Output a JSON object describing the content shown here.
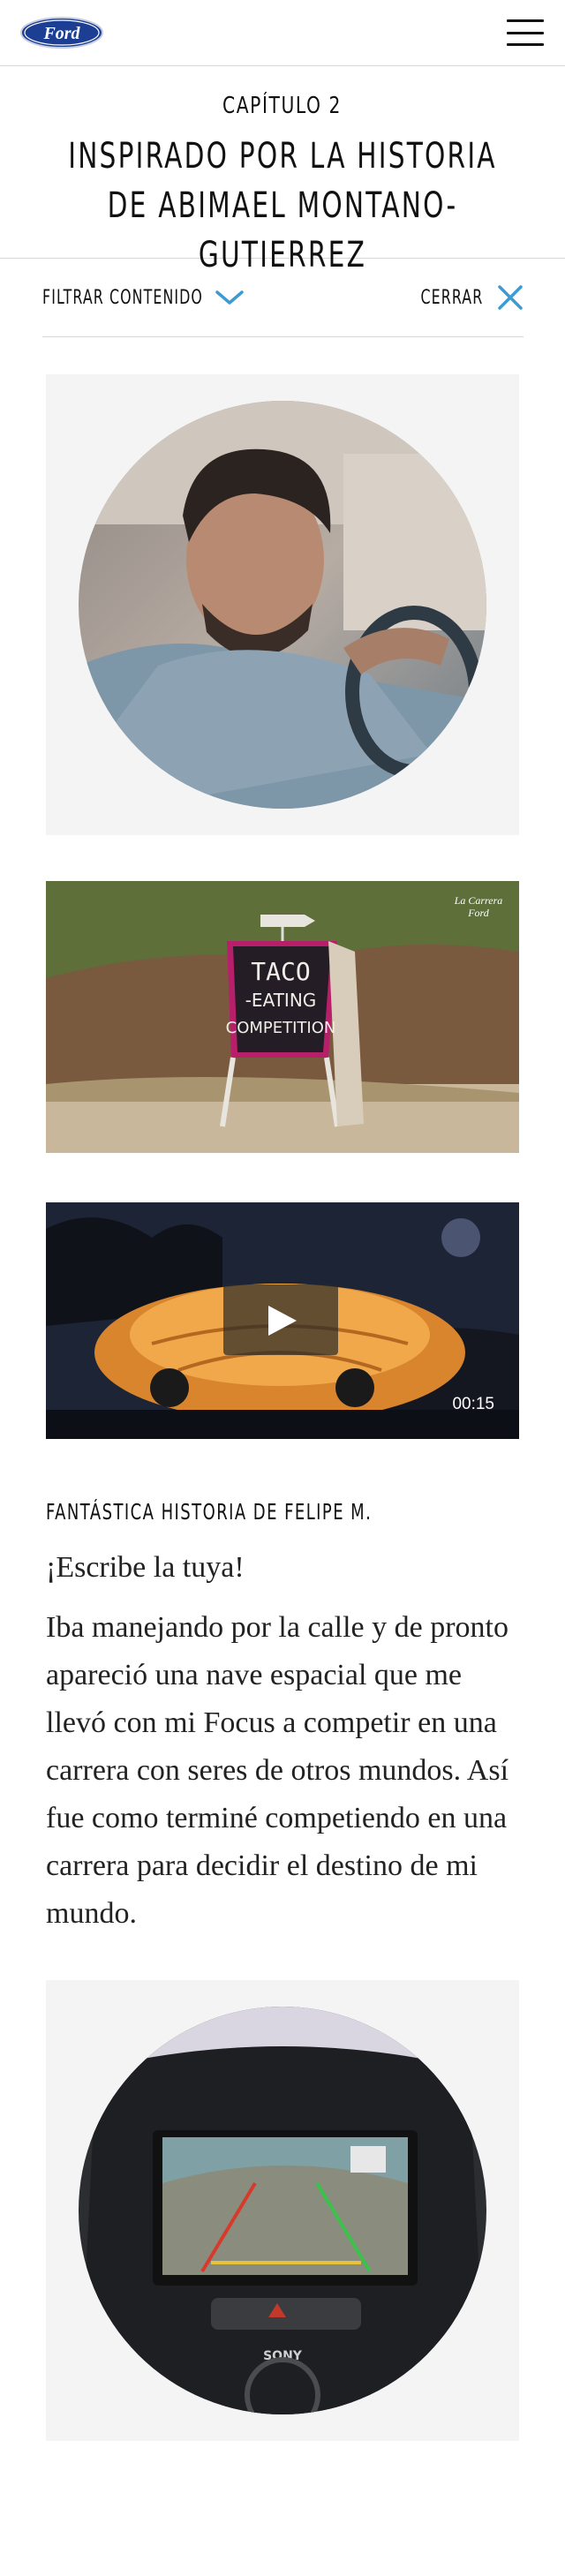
{
  "header": {
    "logo_text": "Ford",
    "menu_icon": "hamburger-menu-icon"
  },
  "chapter": {
    "label": "CAPÍTULO 2",
    "title": "INSPIRADO POR LA HISTORIA DE ABIMAEL MONTANO-GUTIERREZ"
  },
  "filter_bar": {
    "filter_label": "FILTRAR CONTENIDO",
    "filter_icon": "chevron-down-icon",
    "close_label": "CERRAR",
    "close_icon": "close-icon"
  },
  "media": {
    "image2_sign_text": "TACO EATING COMPETITION",
    "video_duration": "00:15"
  },
  "story": {
    "title": "FANTÁSTICA HISTORIA DE FELIPE M.",
    "subtitle": "¡Escribe la tuya!",
    "body": "Iba manejando por la calle y de pronto apareció una nave espacial que me llevó con mi Focus a competir en una carrera con seres de otros mundos. Así fue como terminé competiendo en una carrera para decidir el destino de mi mundo."
  },
  "colors": {
    "ford_blue": "#1c3f94",
    "accent_blue": "#3d9bd4",
    "card_bg": "#f4f4f4"
  }
}
